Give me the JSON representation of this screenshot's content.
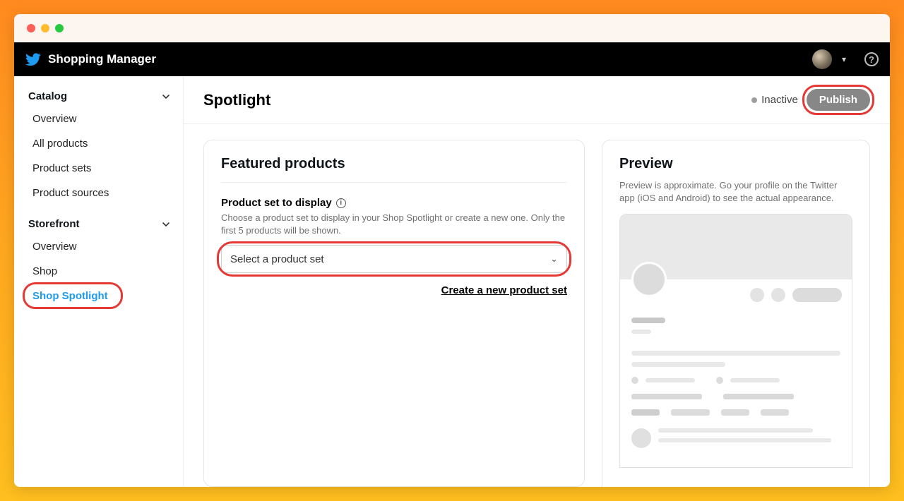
{
  "topbar": {
    "title": "Shopping Manager"
  },
  "sidebar": {
    "catalog": {
      "label": "Catalog",
      "items": [
        "Overview",
        "All products",
        "Product sets",
        "Product sources"
      ]
    },
    "storefront": {
      "label": "Storefront",
      "items": [
        "Overview",
        "Shop",
        "Shop Spotlight"
      ]
    }
  },
  "page": {
    "title": "Spotlight",
    "status_label": "Inactive",
    "publish_label": "Publish"
  },
  "featured": {
    "title": "Featured products",
    "field_label": "Product set to display",
    "help": "Choose a product set to display in your Shop Spotlight or create a new one. Only the first 5 products will be shown.",
    "select_placeholder": "Select a product set",
    "create_link": "Create a new product set"
  },
  "preview": {
    "title": "Preview",
    "sub": "Preview is approximate. Go your profile on the Twitter app (iOS and Android) to see the actual appearance."
  }
}
